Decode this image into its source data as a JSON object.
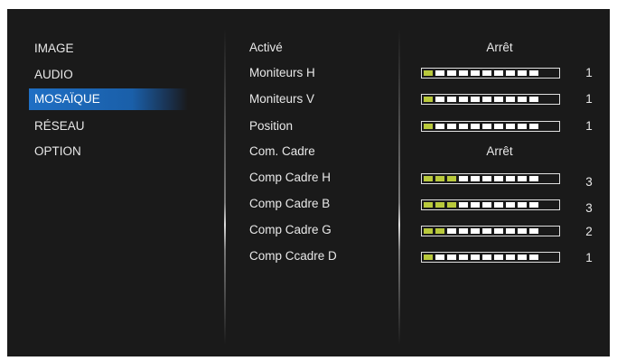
{
  "menu": {
    "items": [
      {
        "label": "IMAGE",
        "selected": false
      },
      {
        "label": "AUDIO",
        "selected": false
      },
      {
        "label": "MOSAÏQUE",
        "selected": true
      },
      {
        "label": "RÉSEAU",
        "selected": false
      },
      {
        "label": "OPTION",
        "selected": false
      }
    ]
  },
  "settings": {
    "active": {
      "label": "Activé",
      "value": "Arrêt"
    },
    "monitors_h": {
      "label": "Moniteurs H",
      "value": "1",
      "level": 1,
      "max": 10
    },
    "monitors_v": {
      "label": "Moniteurs V",
      "value": "1",
      "level": 1,
      "max": 10
    },
    "position": {
      "label": "Position",
      "value": "1",
      "level": 1,
      "max": 10
    },
    "frame_comp": {
      "label": "Com. Cadre",
      "value": "Arrêt"
    },
    "frame_comp_h": {
      "label": "Comp Cadre H",
      "value": "3",
      "level": 3,
      "max": 10
    },
    "frame_comp_b": {
      "label": "Comp Cadre B",
      "value": "3",
      "level": 3,
      "max": 10
    },
    "frame_comp_g": {
      "label": "Comp Cadre G",
      "value": "2",
      "level": 2,
      "max": 10
    },
    "frame_comp_d": {
      "label": "Comp Ccadre D",
      "value": "1",
      "level": 1,
      "max": 10
    }
  },
  "colors": {
    "background": "#1a1a1a",
    "selected": "#1f6fc4",
    "slider_on": "#b9c93c",
    "slider_off": "#ffffff"
  }
}
